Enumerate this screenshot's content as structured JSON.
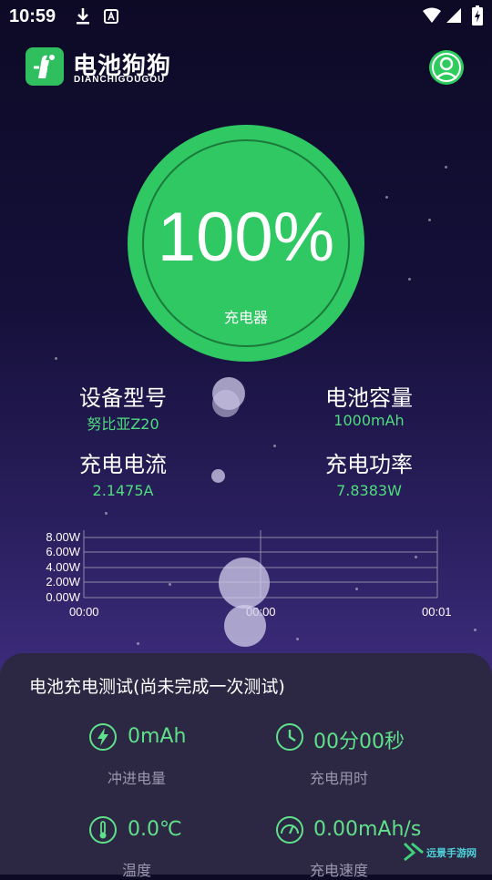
{
  "status_bar": {
    "time": "10:59"
  },
  "header": {
    "app_name": "电池狗狗",
    "app_subtitle": "DIANCHIGOUGOU"
  },
  "battery": {
    "percent": "100%",
    "source": "充电器"
  },
  "stats": [
    {
      "label": "设备型号",
      "value": "努比亚Z20"
    },
    {
      "label": "电池容量",
      "value": "1000mAh"
    },
    {
      "label": "充电电流",
      "value": "2.1475A"
    },
    {
      "label": "充电功率",
      "value": "7.8383W"
    }
  ],
  "chart_data": {
    "type": "line",
    "y_ticks": [
      "8.00W",
      "6.00W",
      "4.00W",
      "2.00W",
      "0.00W"
    ],
    "x_ticks": [
      "00:00",
      "00:00",
      "00:01"
    ],
    "ylim": [
      0,
      8
    ],
    "series": [
      {
        "values": []
      }
    ],
    "grid": true
  },
  "test_panel": {
    "title": "电池充电测试(尚未完成一次测试)",
    "metrics": [
      {
        "icon": "bolt-icon",
        "value": "0mAh",
        "label": "冲进电量"
      },
      {
        "icon": "clock-icon",
        "value": "00分00秒",
        "label": "充电用时"
      },
      {
        "icon": "thermometer-icon",
        "value": "0.0℃",
        "label": "温度"
      },
      {
        "icon": "speedometer-icon",
        "value": "0.00mAh/s",
        "label": "充电速度"
      }
    ]
  },
  "watermark": {
    "text": "远景手游网"
  },
  "colors": {
    "accent": "#2fc862",
    "value_green": "#4fdc7e",
    "panel": "#2c2742"
  }
}
